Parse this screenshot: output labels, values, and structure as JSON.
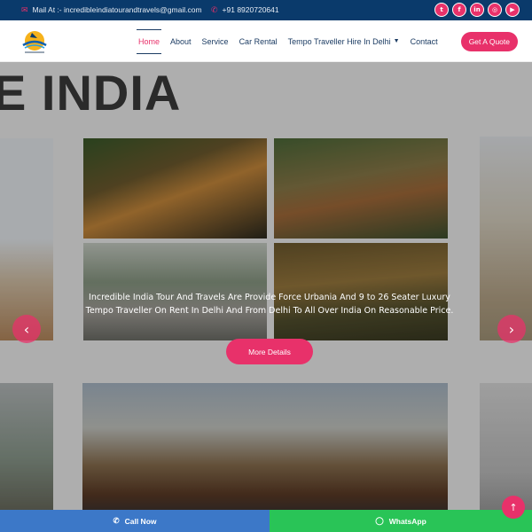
{
  "topbar": {
    "mail_text": "Mail At :- incredibleindiatourandtravels@gmail.com",
    "phone_text": "+91 8920720641",
    "socials": [
      {
        "icon": "twitter-icon",
        "glyph": "t"
      },
      {
        "icon": "facebook-icon",
        "glyph": "f"
      },
      {
        "icon": "linkedin-icon",
        "glyph": "in"
      },
      {
        "icon": "instagram-icon",
        "glyph": "◎"
      },
      {
        "icon": "youtube-icon",
        "glyph": "▶"
      }
    ]
  },
  "nav": {
    "items": [
      {
        "label": "Home",
        "active": true
      },
      {
        "label": "About"
      },
      {
        "label": "Service"
      },
      {
        "label": "Car Rental"
      },
      {
        "label": "Tempo Traveller Hire In Delhi",
        "dropdown": true
      },
      {
        "label": "Contact"
      }
    ],
    "quote_button": "Get A Quote"
  },
  "hero": {
    "heading": "E INDIA",
    "caption": "Incredible India Tour And Travels Are Provide Force Urbania And 9 to 26 Seater Luxury Tempo Traveller On Rent In Delhi And From Delhi To All Over India On Reasonable Price.",
    "button": "More Details",
    "prev_glyph": "‹",
    "next_glyph": "›"
  },
  "bottombar": {
    "call_label": "Call Now",
    "whatsapp_label": "WhatsApp"
  },
  "colors": {
    "topbar_bg": "#0a3a6b",
    "accent": "#e8316a",
    "nav_text": "#1c3c63",
    "call_bg": "#3c78c8",
    "whatsapp_bg": "#29c457"
  }
}
